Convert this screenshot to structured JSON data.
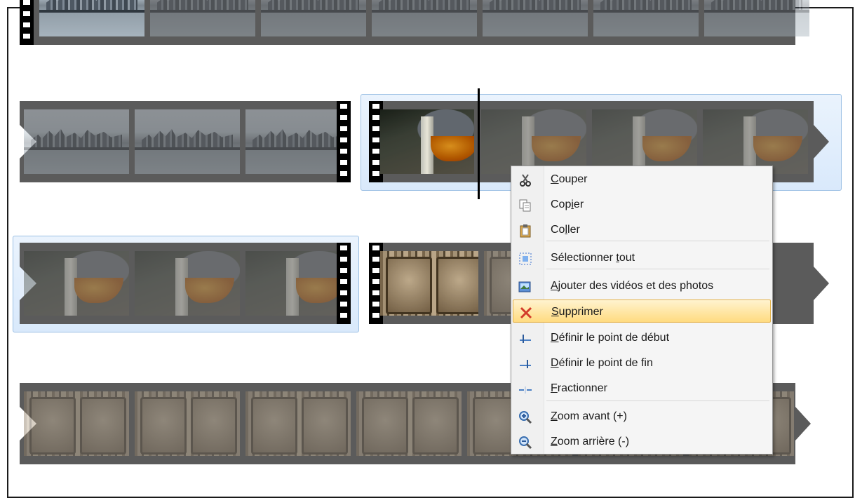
{
  "menu": {
    "items": [
      {
        "pre": "",
        "u": "C",
        "post": "ouper",
        "icon": "scissors-icon"
      },
      {
        "pre": "Cop",
        "u": "i",
        "post": "er",
        "icon": "copy-icon"
      },
      {
        "pre": "Co",
        "u": "l",
        "post": "ler",
        "icon": "paste-icon"
      },
      {
        "pre": "Sélectionner ",
        "u": "t",
        "post": "out",
        "icon": "select-all-icon"
      },
      {
        "pre": "",
        "u": "A",
        "post": "jouter des vidéos et des photos",
        "icon": "add-media-icon"
      },
      {
        "pre": "",
        "u": "S",
        "post": "upprimer",
        "icon": "delete-icon"
      },
      {
        "pre": "",
        "u": "D",
        "post": "éfinir le point de début",
        "icon": "set-start-point-icon"
      },
      {
        "pre": "",
        "u": "D",
        "post": "éfinir le point de fin",
        "icon": "set-end-point-icon"
      },
      {
        "pre": "",
        "u": "F",
        "post": "ractionner",
        "icon": "split-icon"
      },
      {
        "pre": "",
        "u": "Z",
        "post": "oom avant (+)",
        "icon": "zoom-in-icon"
      },
      {
        "pre": "",
        "u": "Z",
        "post": "oom arrière (-)",
        "icon": "zoom-out-icon"
      }
    ],
    "highlighted": "Supprimer"
  },
  "colors": {
    "highlight": "#ffdb80",
    "selection": "#d9e9fb",
    "film": "#5b5b5b"
  }
}
